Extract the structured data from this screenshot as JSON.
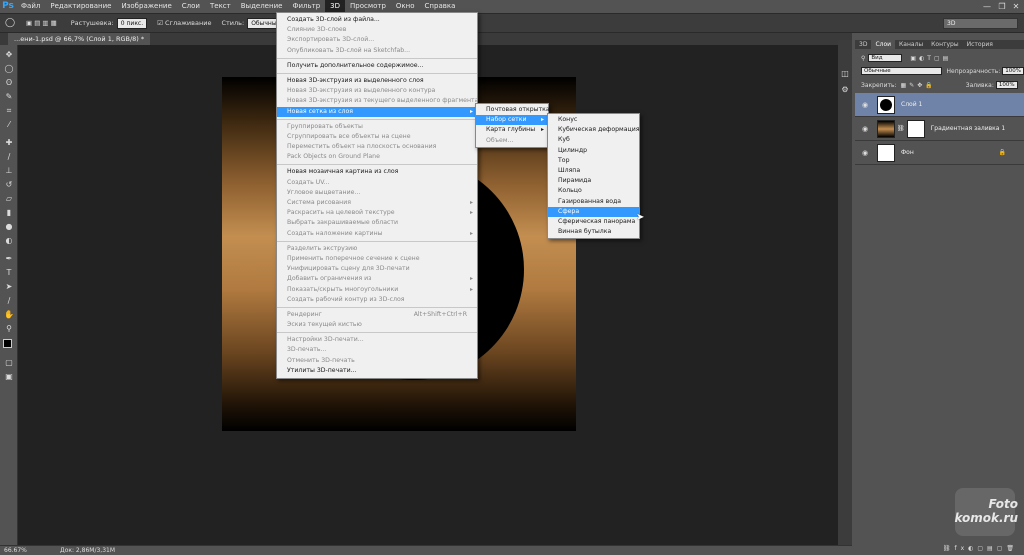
{
  "menubar": {
    "logo": "Ps",
    "items": [
      "Файл",
      "Редактирование",
      "Изображение",
      "Слои",
      "Текст",
      "Выделение",
      "Фильтр",
      "3D",
      "Просмотр",
      "Окно",
      "Справка"
    ],
    "controls": [
      "—",
      "❐",
      "✕"
    ]
  },
  "options": {
    "feather_label": "Растушевка:",
    "feather_value": "0 пикс.",
    "antialias_label": "Сглаживание",
    "style_label": "Стиль:",
    "style_value": "Обычный",
    "workspace": "3D"
  },
  "document": {
    "tab_title": "...ени-1.psd @ 66,7% (Слой 1, RGB/8) *",
    "zoom": "66.67%",
    "doc_size": "Док: 2,86M/3,31M"
  },
  "menu_3d": {
    "groups": [
      [
        {
          "label": "Создать 3D-слой из файла...",
          "enabled": true
        },
        {
          "label": "Слияние 3D-слоев",
          "enabled": false
        },
        {
          "label": "Экспортировать 3D-слой...",
          "enabled": false
        },
        {
          "label": "Опубликовать 3D-слой на Sketchfab...",
          "enabled": false
        }
      ],
      [
        {
          "label": "Получить дополнительное содержимое...",
          "enabled": true
        }
      ],
      [
        {
          "label": "Новая 3D-экструзия из выделенного слоя",
          "enabled": true
        },
        {
          "label": "Новая 3D-экструзия из выделенного контура",
          "enabled": false
        },
        {
          "label": "Новая 3D-экструзия из текущего выделенного фрагмента",
          "enabled": false
        },
        {
          "label": "Новая сетка из слоя",
          "enabled": true,
          "submenu": true,
          "highlighted": true
        }
      ],
      [
        {
          "label": "Группировать объекты",
          "enabled": false
        },
        {
          "label": "Сгруппировать все объекты на сцене",
          "enabled": false
        },
        {
          "label": "Переместить объект на плоскость основания",
          "enabled": false
        },
        {
          "label": "Pack Objects on Ground Plane",
          "enabled": false
        }
      ],
      [
        {
          "label": "Новая мозаичная картина из слоя",
          "enabled": true
        },
        {
          "label": "Создать UV...",
          "enabled": false
        },
        {
          "label": "Угловое выцветание...",
          "enabled": false
        },
        {
          "label": "Система рисования",
          "enabled": false,
          "submenu": true
        },
        {
          "label": "Раскрасить на целевой текстуре",
          "enabled": false,
          "submenu": true
        },
        {
          "label": "Выбрать закрашиваемые области",
          "enabled": false
        },
        {
          "label": "Создать наложение картины",
          "enabled": false,
          "submenu": true
        }
      ],
      [
        {
          "label": "Разделить экструзию",
          "enabled": false
        },
        {
          "label": "Применить поперечное сечение к сцене",
          "enabled": false
        },
        {
          "label": "Унифицировать сцену для 3D-печати",
          "enabled": false
        },
        {
          "label": "Добавить ограничения из",
          "enabled": false,
          "submenu": true
        },
        {
          "label": "Показать/скрыть многоугольники",
          "enabled": false,
          "submenu": true
        },
        {
          "label": "Создать рабочий контур из 3D-слоя",
          "enabled": false
        }
      ],
      [
        {
          "label": "Рендеринг",
          "enabled": false,
          "shortcut": "Alt+Shift+Ctrl+R"
        },
        {
          "label": "Эскиз текущей кистью",
          "enabled": false
        }
      ],
      [
        {
          "label": "Настройки 3D-печати...",
          "enabled": false
        },
        {
          "label": "3D-печать...",
          "enabled": false
        },
        {
          "label": "Отменить 3D-печать",
          "enabled": false
        },
        {
          "label": "Утилиты 3D-печати...",
          "enabled": true
        }
      ]
    ]
  },
  "submenu_mesh": [
    {
      "label": "Почтовая открытка",
      "enabled": true
    },
    {
      "label": "Набор сетки",
      "enabled": true,
      "submenu": true,
      "highlighted": true
    },
    {
      "label": "Карта глубины",
      "enabled": true,
      "submenu": true
    },
    {
      "label": "Объем...",
      "enabled": false
    }
  ],
  "submenu_presets": [
    {
      "label": "Конус"
    },
    {
      "label": "Кубическая деформация"
    },
    {
      "label": "Куб"
    },
    {
      "label": "Цилиндр"
    },
    {
      "label": "Тор"
    },
    {
      "label": "Шляпа"
    },
    {
      "label": "Пирамида"
    },
    {
      "label": "Кольцо"
    },
    {
      "label": "Газированная вода"
    },
    {
      "label": "Сфера",
      "highlighted": true
    },
    {
      "label": "Сферическая панорама"
    },
    {
      "label": "Винная бутылка"
    }
  ],
  "layers_panel": {
    "tabs": [
      "3D",
      "Слои",
      "Каналы",
      "Контуры",
      "История"
    ],
    "active_tab": "Слои",
    "kind": "Вид",
    "blend_mode": "Обычные",
    "opacity_label": "Непрозрачность:",
    "opacity": "100%",
    "lock_label": "Закрепить:",
    "fill_label": "Заливка:",
    "fill": "100%",
    "layers": [
      {
        "name": "Слой 1",
        "selected": true
      },
      {
        "name": "Градиентная заливка 1",
        "selected": false
      },
      {
        "name": "Фон",
        "selected": false
      }
    ]
  },
  "watermark": {
    "line1": "Foto",
    "line2": "komok.ru"
  },
  "colors": {
    "menu_highlight": "#3399ff",
    "selected_layer": "#6f83a8",
    "ui_bg": "#535353"
  }
}
